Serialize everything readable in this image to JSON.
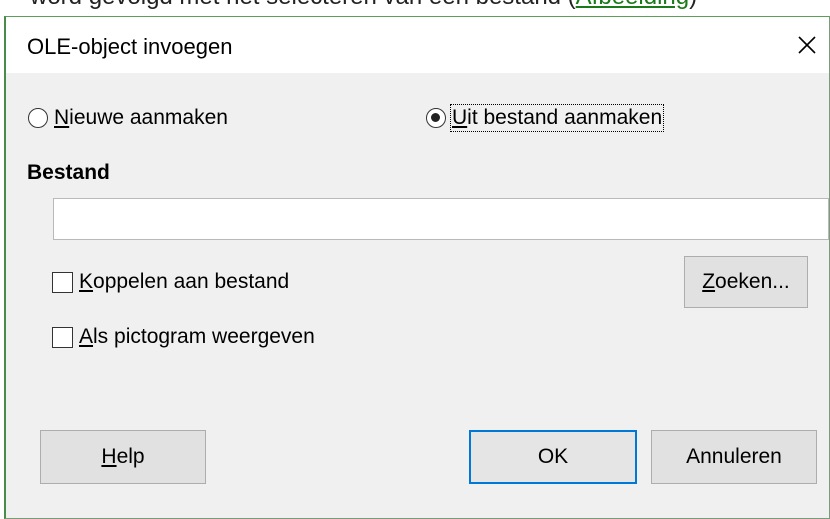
{
  "background": {
    "text_before": "word gevolgd met het selecteren van een bestand (",
    "link": "Afbeelding",
    "text_after": ")"
  },
  "dialog": {
    "title": "OLE-object invoegen",
    "close_icon": "close-icon",
    "radio_new": {
      "label_first": "N",
      "label_rest": "ieuwe aanmaken",
      "checked": false
    },
    "radio_file": {
      "label_first": "U",
      "label_rest": "it bestand aanmaken",
      "checked": true
    },
    "file_section_label": "Bestand",
    "file_input": {
      "value": "",
      "placeholder": ""
    },
    "check_link": {
      "label_first": "K",
      "label_rest": "oppelen aan bestand",
      "checked": false
    },
    "check_icon": {
      "label_first": "A",
      "label_rest": "ls pictogram weergeven",
      "checked": false
    },
    "browse_button": {
      "label_first": "Z",
      "label_rest": "oeken..."
    },
    "help_button": {
      "label_first": "H",
      "label_rest": "elp"
    },
    "ok_button": "OK",
    "cancel_button": "Annuleren",
    "accent_color": "#0078d7"
  }
}
